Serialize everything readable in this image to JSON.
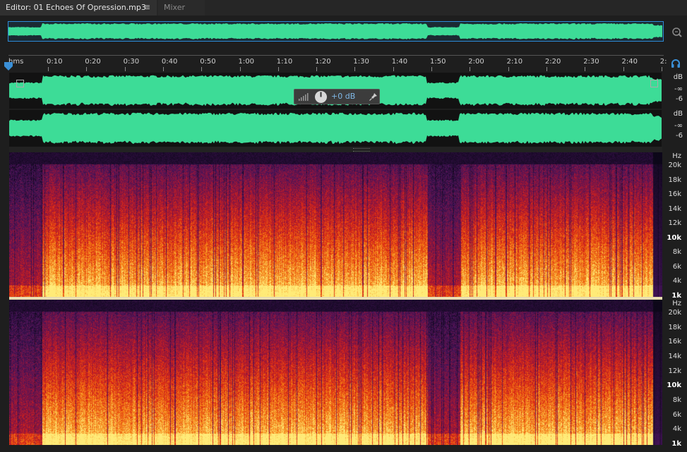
{
  "tabs": [
    {
      "label": "Editor: 01 Echoes Of Opression.mp3",
      "active": true
    },
    {
      "label": "Mixer",
      "active": false
    }
  ],
  "tab_menu_icon": "hamburger-menu-icon",
  "ruler": {
    "unit_label": "hms",
    "ticks": [
      "0:10",
      "0:20",
      "0:30",
      "0:40",
      "0:50",
      "1:00",
      "1:10",
      "1:20",
      "1:30",
      "1:40",
      "1:50",
      "2:00",
      "2:10",
      "2:20",
      "2:30",
      "2:40",
      "2:"
    ]
  },
  "hud": {
    "gain_label": "+0 dB"
  },
  "amplitude_scale": {
    "unit": "dB",
    "labels": [
      "-∞",
      "-6"
    ]
  },
  "frequency_scale": {
    "unit": "Hz",
    "labels": [
      "20k",
      "18k",
      "16k",
      "14k",
      "12k",
      "10k",
      "8k",
      "6k",
      "4k",
      "1k"
    ],
    "bold": [
      "10k",
      "1k"
    ]
  },
  "colors": {
    "waveform": "#3ddc97",
    "overview_border": "#2d8bd8",
    "accent_blue": "#3a8fd6"
  }
}
